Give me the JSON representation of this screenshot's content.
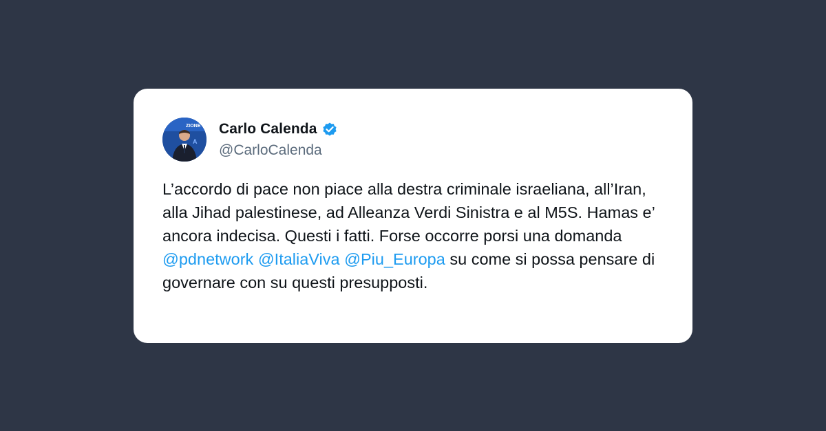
{
  "tweet": {
    "author_name": "Carlo Calenda",
    "author_handle": "@CarloCalenda",
    "verified_icon": "verified-badge-icon",
    "text_part_1": "L’accordo di pace non piace alla destra criminale israeliana, all’Iran, alla Jihad palestinese, ad Alleanza Verdi Sinistra e al M5S. Hamas e’ ancora indecisa. Questi i fatti. Forse occorre porsi una domanda",
    "mentions": [
      "@pdnetwork",
      "@ItaliaViva",
      "@Piu_Europa"
    ],
    "text_part_2": "su come si possa pensare di governare con su questi presupposti."
  },
  "colors": {
    "background": "#2e3646",
    "card": "#ffffff",
    "text": "#0f1419",
    "handle": "#5b6b7c",
    "mention": "#1d9bf0",
    "verified": "#1d9bf0"
  }
}
